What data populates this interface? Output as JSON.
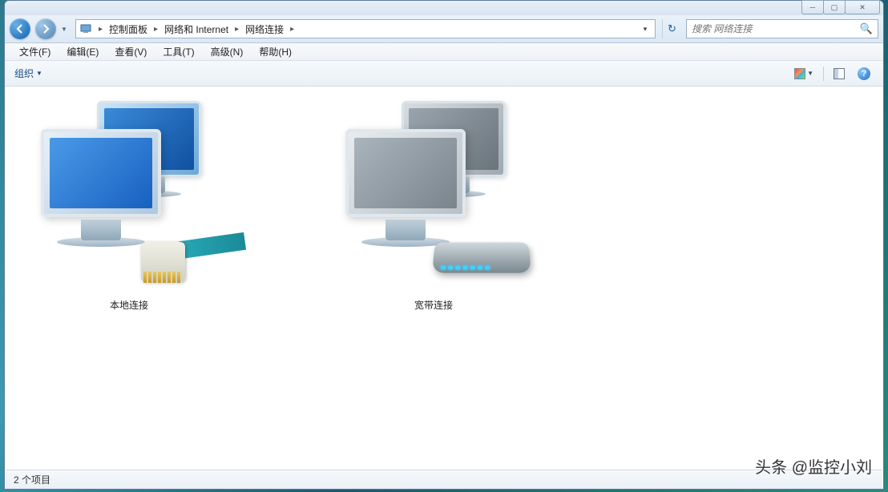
{
  "breadcrumb": {
    "items": [
      "控制面板",
      "网络和 Internet",
      "网络连接"
    ]
  },
  "search": {
    "placeholder": "搜索 网络连接"
  },
  "menubar": {
    "items": [
      "文件(F)",
      "编辑(E)",
      "查看(V)",
      "工具(T)",
      "高级(N)",
      "帮助(H)"
    ]
  },
  "toolbar": {
    "organize": "组织"
  },
  "content": {
    "items": [
      {
        "label": "本地连接",
        "kind": "ethernet"
      },
      {
        "label": "宽带连接",
        "kind": "broadband"
      }
    ]
  },
  "statusbar": {
    "text": "2 个项目"
  },
  "watermark": "头条 @监控小刘"
}
